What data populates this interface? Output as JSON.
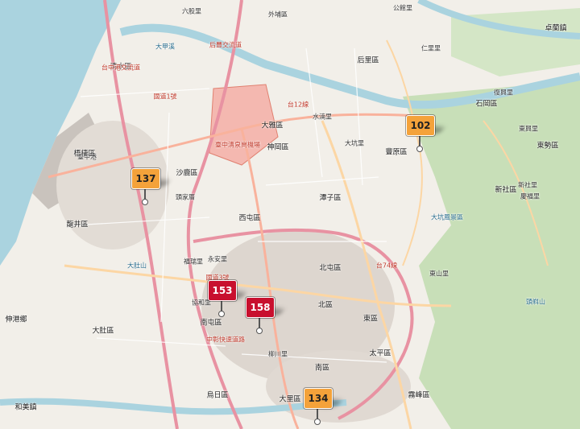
{
  "map": {
    "place_labels": [
      {
        "text": "六股里"
      },
      {
        "text": "外埔區"
      },
      {
        "text": "公館里"
      },
      {
        "text": "仁里里"
      },
      {
        "text": "大甲溪"
      },
      {
        "text": "后里區"
      },
      {
        "text": "卓蘭鎮"
      },
      {
        "text": "臺中港"
      },
      {
        "text": "清水區"
      },
      {
        "text": "梧棲區"
      },
      {
        "text": "沙鹿區"
      },
      {
        "text": "龍井區"
      },
      {
        "text": "大肚區"
      },
      {
        "text": "伸港鄉"
      },
      {
        "text": "和美鎮"
      },
      {
        "text": "大雅區"
      },
      {
        "text": "神岡區"
      },
      {
        "text": "豐原區"
      },
      {
        "text": "潭子區"
      },
      {
        "text": "北屯區"
      },
      {
        "text": "西屯區"
      },
      {
        "text": "南屯區"
      },
      {
        "text": "北區"
      },
      {
        "text": "東區"
      },
      {
        "text": "南區"
      },
      {
        "text": "大里區"
      },
      {
        "text": "太平區"
      },
      {
        "text": "石岡區"
      },
      {
        "text": "東勢區"
      },
      {
        "text": "新社區"
      },
      {
        "text": "大坑里"
      },
      {
        "text": "烏日區"
      },
      {
        "text": "霧峰區"
      },
      {
        "text": "臺中清泉崗機場"
      },
      {
        "text": "頭家厝"
      },
      {
        "text": "水湳里"
      },
      {
        "text": "大肚山"
      },
      {
        "text": "協和里"
      },
      {
        "text": "福瑞里"
      },
      {
        "text": "永安里"
      },
      {
        "text": "大坑風景區"
      },
      {
        "text": "東山里"
      },
      {
        "text": "頭嵙山"
      },
      {
        "text": "新社里"
      },
      {
        "text": "慶福里"
      },
      {
        "text": "復興里"
      },
      {
        "text": "東興里"
      },
      {
        "text": "柳川里"
      }
    ],
    "road_labels": [
      {
        "text": "國道1號"
      },
      {
        "text": "國道3號"
      },
      {
        "text": "台74線"
      },
      {
        "text": "台12線"
      },
      {
        "text": "中彰快速道路"
      },
      {
        "text": "后豐交流道"
      },
      {
        "text": "台中港交流道"
      }
    ],
    "markers": [
      {
        "aqi": "137",
        "level": "orange"
      },
      {
        "aqi": "102",
        "level": "orange"
      },
      {
        "aqi": "153",
        "level": "red"
      },
      {
        "aqi": "158",
        "level": "red"
      },
      {
        "aqi": "134",
        "level": "orange"
      }
    ],
    "colors": {
      "land": "#f2efe9",
      "sea": "#aad3df",
      "forest": "#c8dfb8",
      "urban": "#d9d0c9",
      "motorway": "#e892a2",
      "trunk": "#f9b29c",
      "primary": "#fcd6a4",
      "aqi_orange": "#f4a23a",
      "aqi_red": "#c8102e"
    }
  }
}
